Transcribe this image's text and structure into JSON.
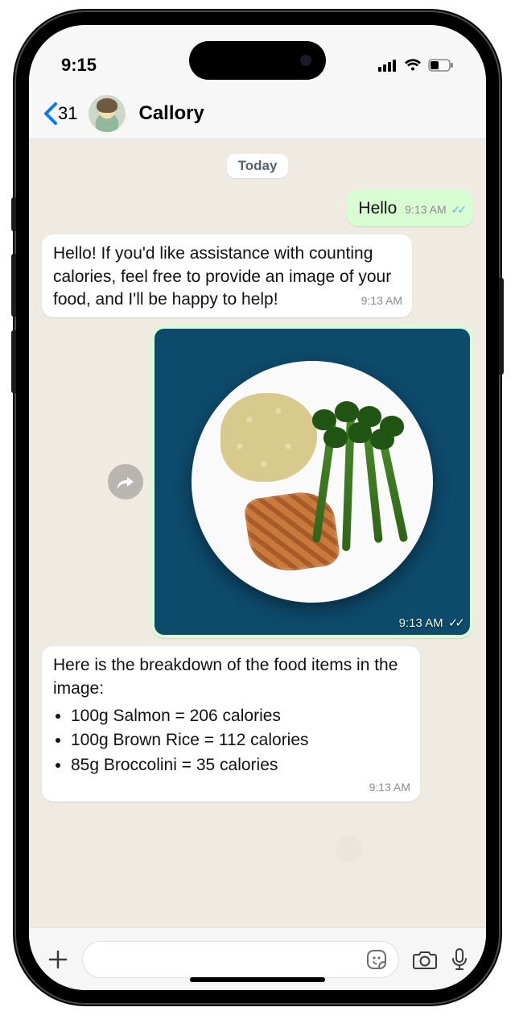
{
  "status": {
    "time": "9:15"
  },
  "header": {
    "back_count": "31",
    "contact_name": "Callory"
  },
  "chat": {
    "date_label": "Today",
    "msg_out_1": {
      "text": "Hello",
      "time": "9:13 AM"
    },
    "msg_in_1": {
      "text": "Hello! If you'd like assistance with counting calories, feel free to provide an image of your food, and I'll be happy to help!",
      "time": "9:13 AM"
    },
    "msg_out_img": {
      "time": "9:13 AM"
    },
    "msg_in_2": {
      "intro": "Here is the breakdown of the food items in the image:",
      "items": [
        "100g Salmon = 206 calories",
        "100g Brown Rice = 112 calories",
        "85g Broccolini = 35 calories"
      ],
      "time": "9:13 AM"
    }
  }
}
